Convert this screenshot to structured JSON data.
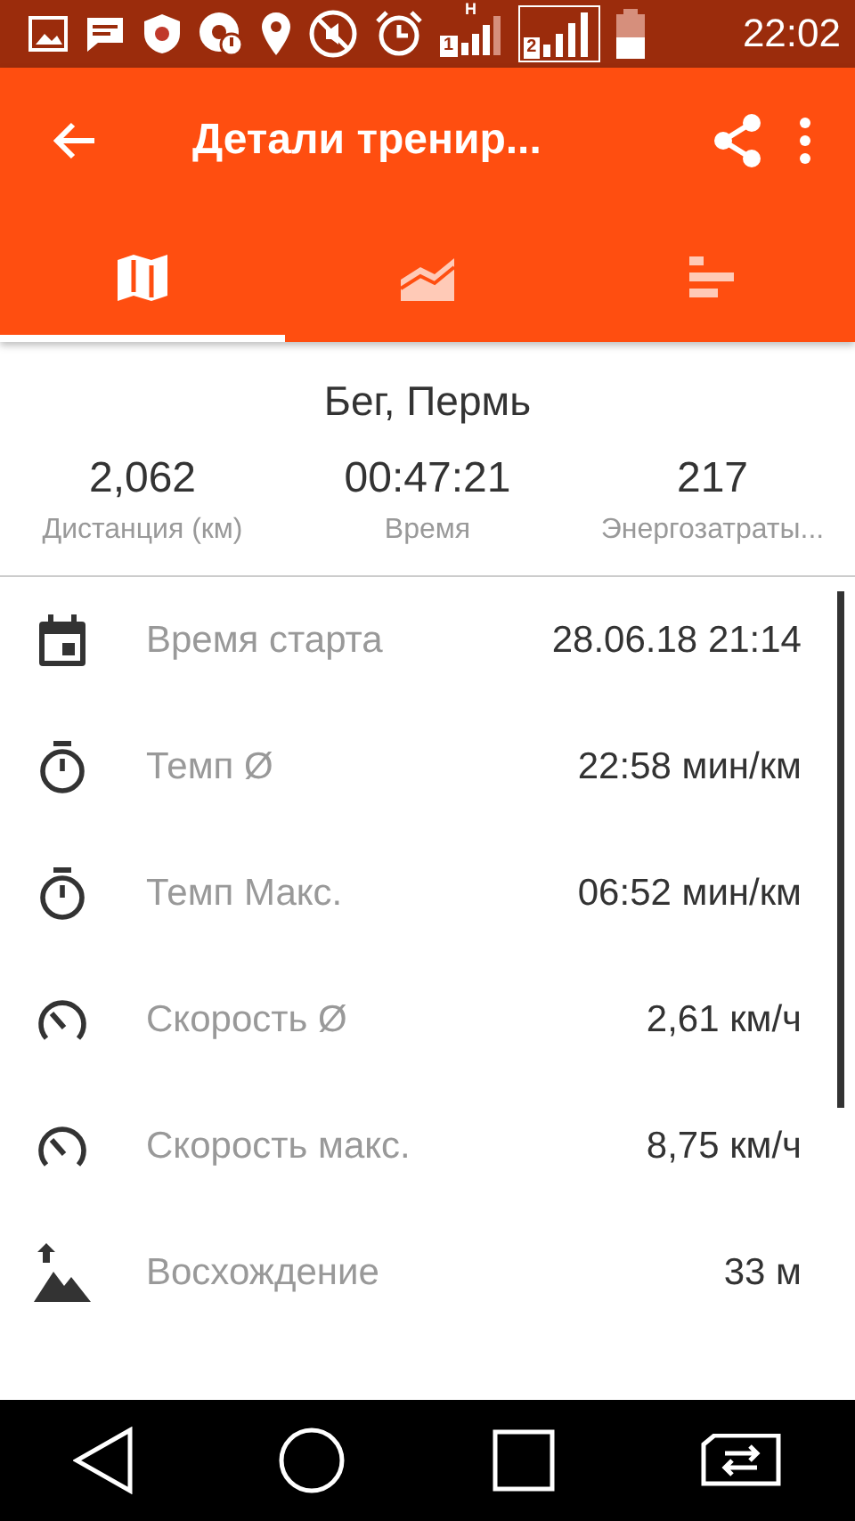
{
  "status_bar": {
    "time": "22:02",
    "sim_1": "1",
    "sim_2": "2",
    "network_type": "H"
  },
  "app_bar": {
    "title": "Детали тренир..."
  },
  "tabs": [
    {
      "kind": "map",
      "selected": true
    },
    {
      "kind": "chart",
      "selected": false
    },
    {
      "kind": "bars",
      "selected": false
    }
  ],
  "summary": {
    "title": "Бег, Пермь",
    "stats": [
      {
        "value": "2,062",
        "label": "Дистанция (км)"
      },
      {
        "value": "00:47:21",
        "label": "Время"
      },
      {
        "value": "217",
        "label": "Энергозатраты..."
      }
    ]
  },
  "rows": [
    {
      "kind": "calendar",
      "label": "Время старта",
      "value": "28.06.18 21:14"
    },
    {
      "kind": "stopwatch",
      "label": "Темп Ø",
      "value": "22:58 мин/км"
    },
    {
      "kind": "stopwatch",
      "label": "Темп Макс.",
      "value": "06:52 мин/км"
    },
    {
      "kind": "speedometer",
      "label": "Скорость Ø",
      "value": "2,61 км/ч"
    },
    {
      "kind": "speedometer",
      "label": "Скорость макс.",
      "value": "8,75 км/ч"
    },
    {
      "kind": "ascent",
      "label": "Восхождение",
      "value": "33 м"
    }
  ]
}
